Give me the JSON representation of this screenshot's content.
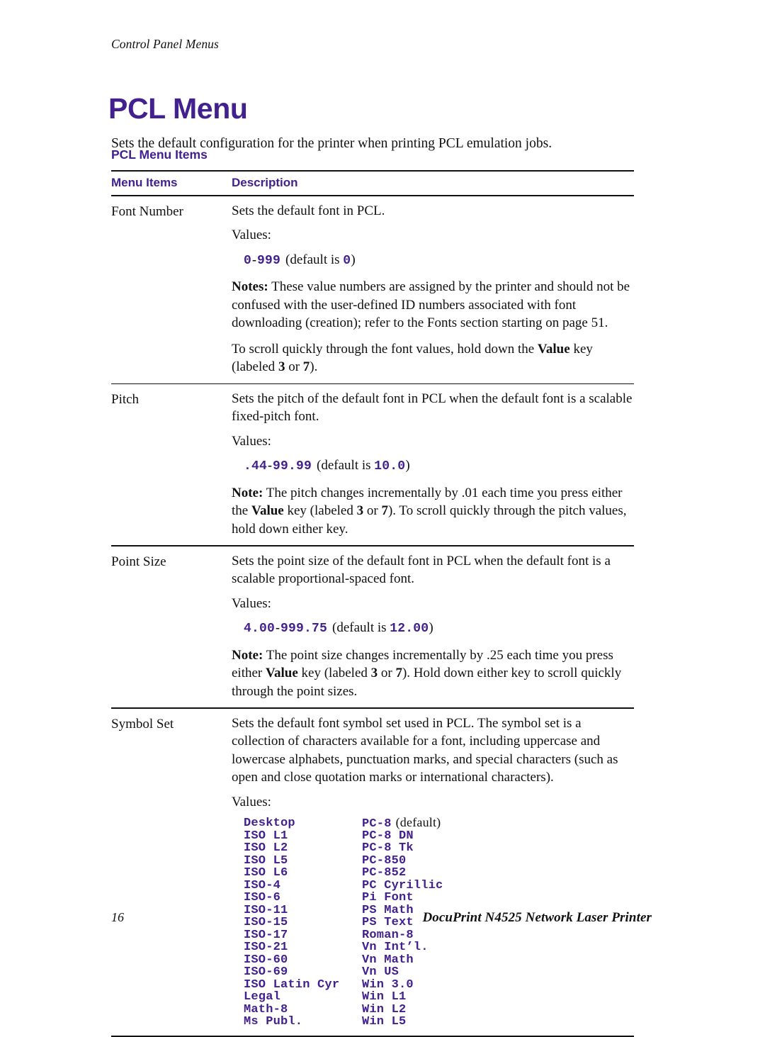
{
  "header": {
    "running_title": "Control Panel Menus"
  },
  "title": "PCL Menu",
  "intro": "Sets the default configuration for the printer when printing PCL emulation jobs.",
  "subhead": "PCL Menu Items",
  "colors": {
    "accent_purple": "#42218F",
    "text_black": "#111111",
    "rule": "#111111"
  },
  "table": {
    "columns": {
      "menu_items": "Menu Items",
      "description": "Description"
    },
    "rows": {
      "font_number": {
        "name": "Font Number",
        "desc_1": "Sets the default font in PCL.",
        "values_label": "Values:",
        "range_low": "0",
        "range_dash": "-",
        "range_high": "999",
        "default_prefix": "(default is ",
        "default_value": "0",
        "default_suffix": ")",
        "note_label": "Notes:",
        "note_body": " These value numbers are assigned by the printer and should not be confused with the user-defined ID numbers associated with font downloading (creation); refer to the Fonts section starting on page 51.",
        "scroll_1": "To scroll quickly through the font values, hold down the ",
        "scroll_value_key": "Value",
        "scroll_2": " key (labeled ",
        "scroll_key_a": "3",
        "scroll_or": " or ",
        "scroll_key_b": "7",
        "scroll_3": ")."
      },
      "pitch": {
        "name": "Pitch",
        "desc_1": "Sets the pitch of the default font in PCL when the default font is a scalable fixed-pitch font.",
        "values_label": "Values:",
        "range_low": ".44",
        "range_dash": "-",
        "range_high": "99.99",
        "default_prefix": "(default is ",
        "default_value": "10.0",
        "default_suffix": ")",
        "note_label": "Note:",
        "note_1": " The pitch changes incrementally by .01 each time you press either the ",
        "note_value_key": "Value",
        "note_2": " key (labeled ",
        "note_key_a": "3",
        "note_or": " or ",
        "note_key_b": "7",
        "note_3": "). To scroll quickly through the pitch values, hold down either key."
      },
      "point_size": {
        "name": "Point Size",
        "desc_1": "Sets the point size of the default font in PCL when the default font is a scalable proportional-spaced font.",
        "values_label": "Values:",
        "range_low": "4.00",
        "range_dash": "-",
        "range_high": "999.75",
        "default_prefix": "(default is ",
        "default_value": "12.00",
        "default_suffix": ")",
        "note_label": "Note:",
        "note_1": " The point size changes incrementally by .25 each time you press either ",
        "note_value_key": "Value",
        "note_2": " key (labeled ",
        "note_key_a": "3",
        "note_or": " or ",
        "note_key_b": "7",
        "note_3": "). Hold down either key to scroll quickly through the point sizes."
      },
      "symbol_set": {
        "name": "Symbol Set",
        "desc_1": "Sets the default font symbol set used in PCL. The symbol set is a collection of characters available for a font, including uppercase and lowercase alphabets, punctuation marks, and special characters (such as open and close quotation marks or international characters).",
        "values_label": "Values:",
        "default_marker": "(default)",
        "values": [
          {
            "left": "Desktop",
            "right": "PC-8",
            "right_default": true
          },
          {
            "left": "ISO L1",
            "right": "PC-8 DN",
            "right_default": false
          },
          {
            "left": "ISO L2",
            "right": "PC-8 Tk",
            "right_default": false
          },
          {
            "left": "ISO L5",
            "right": "PC-850",
            "right_default": false
          },
          {
            "left": "ISO L6",
            "right": "PC-852",
            "right_default": false
          },
          {
            "left": "ISO-4",
            "right": "PC Cyrillic",
            "right_default": false
          },
          {
            "left": "ISO-6",
            "right": "Pi Font",
            "right_default": false
          },
          {
            "left": "ISO-11",
            "right": "PS Math",
            "right_default": false
          },
          {
            "left": "ISO-15",
            "right": "PS Text",
            "right_default": false
          },
          {
            "left": "ISO-17",
            "right": "Roman-8",
            "right_default": false
          },
          {
            "left": "ISO-21",
            "right": "Vn Int’l.",
            "right_default": false
          },
          {
            "left": "ISO-60",
            "right": "Vn Math",
            "right_default": false
          },
          {
            "left": "ISO-69",
            "right": "Vn US",
            "right_default": false
          },
          {
            "left": "ISO Latin Cyr",
            "right": "Win 3.0",
            "right_default": false
          },
          {
            "left": "Legal",
            "right": "Win L1",
            "right_default": false
          },
          {
            "left": "Math-8",
            "right": "Win L2",
            "right_default": false
          },
          {
            "left": "Ms Publ.",
            "right": "Win L5",
            "right_default": false
          }
        ]
      }
    }
  },
  "footer": {
    "page_number": "16",
    "product": "DocuPrint N4525 Network Laser Printer"
  }
}
